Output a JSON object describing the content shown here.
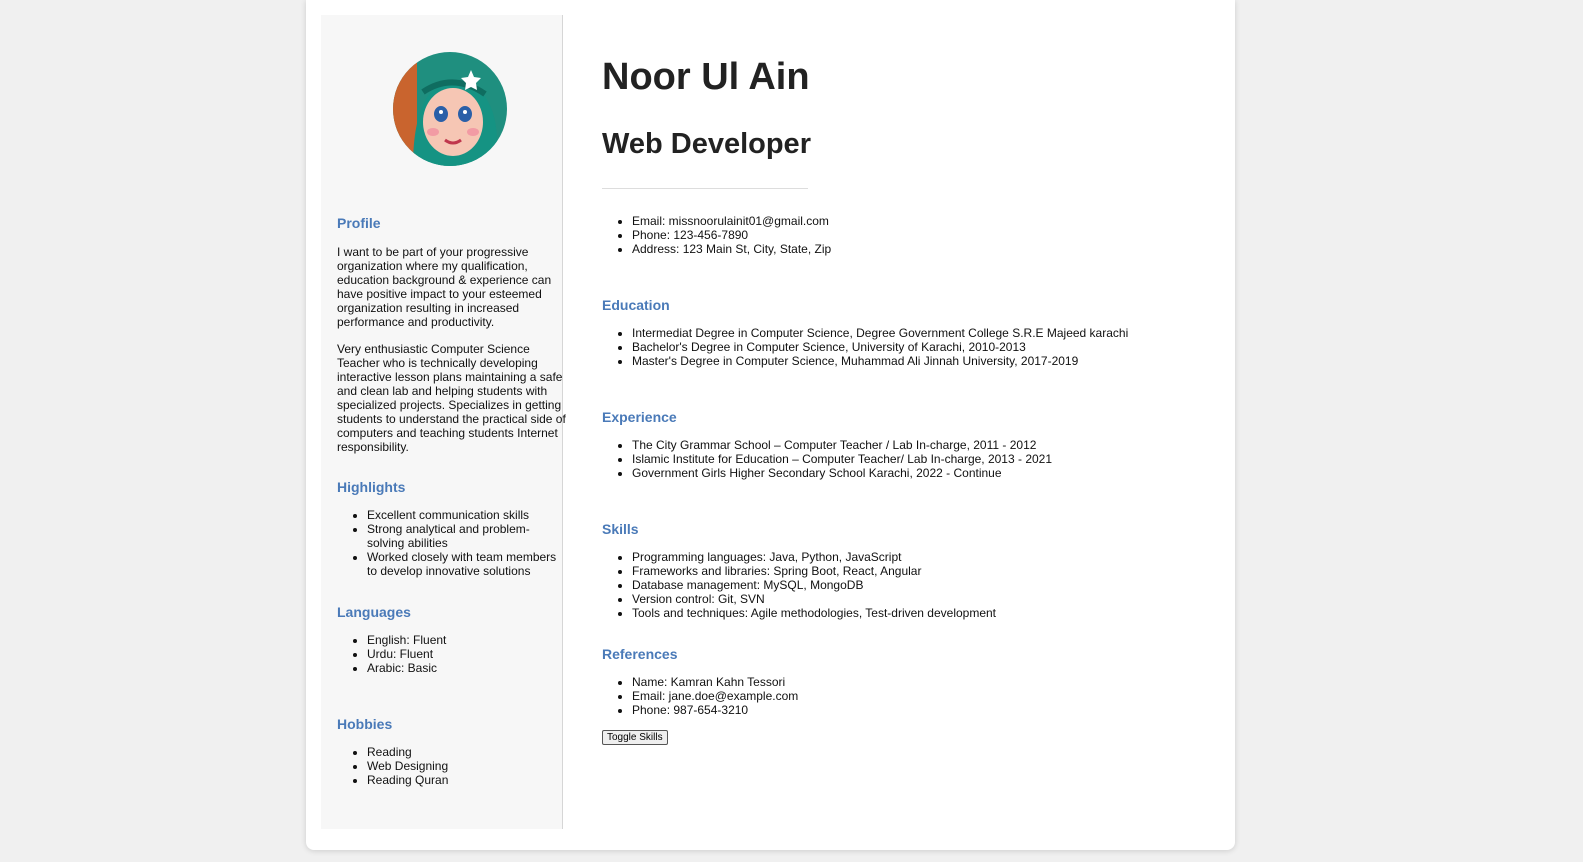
{
  "sidebar": {
    "profile_heading": "Profile",
    "profile_paragraphs": [
      "I want to be part of your progressive organization where my qualification, education background & experience can have positive impact to your esteemed organization resulting in increased performance and productivity.",
      "Very enthusiastic Computer Science Teacher who is technically developing interactive lesson plans maintaining a safe and clean lab and helping students with specialized projects. Specializes in getting students to understand the practical side of computers and teaching students Internet responsibility."
    ],
    "highlights_heading": "Highlights",
    "highlights": [
      "Excellent communication skills",
      "Strong analytical and problem-solving abilities",
      "Worked closely with team members to develop innovative solutions"
    ],
    "languages_heading": "Languages",
    "languages": [
      "English: Fluent",
      "Urdu: Fluent",
      "Arabic: Basic"
    ],
    "hobbies_heading": "Hobbies",
    "hobbies": [
      "Reading",
      "Web Designing",
      "Reading Quran"
    ]
  },
  "main": {
    "name": "Noor Ul Ain",
    "job_title": "Web Developer",
    "contact": [
      "Email: missnoorulainit01@gmail.com",
      "Phone: 123-456-7890",
      "Address: 123 Main St, City, State, Zip"
    ],
    "education_heading": "Education",
    "education": [
      "Intermediat Degree in Computer Science, Degree Government College S.R.E Majeed karachi",
      "Bachelor's Degree in Computer Science, University of Karachi, 2010-2013",
      "Master's Degree in Computer Science, Muhammad Ali Jinnah University, 2017-2019"
    ],
    "experience_heading": "Experience",
    "experience": [
      "The City Grammar School – Computer Teacher / Lab In-charge, 2011 - 2012",
      "Islamic Institute for Education – Computer Teacher/ Lab In-charge, 2013 - 2021",
      "Government Girls Higher Secondary School Karachi, 2022 - Continue"
    ],
    "skills_heading": "Skills",
    "skills": [
      "Programming languages: Java, Python, JavaScript",
      "Frameworks and libraries: Spring Boot, React, Angular",
      "Database management: MySQL, MongoDB",
      "Version control: Git, SVN",
      "Tools and techniques: Agile methodologies, Test-driven development"
    ],
    "references_heading": "References",
    "references": [
      "Name: Kamran Kahn Tessori",
      "Email: jane.doe@example.com",
      "Phone: 987-654-3210"
    ],
    "toggle_button_label": "Toggle Skills"
  }
}
